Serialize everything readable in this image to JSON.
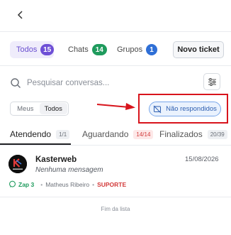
{
  "header": {
    "back_icon": "chevron-left-icon"
  },
  "filters": {
    "items": [
      {
        "label": "Todos",
        "count": "15",
        "color": "#6e4fd6"
      },
      {
        "label": "Chats",
        "count": "14",
        "color": "#1f9b5d"
      },
      {
        "label": "Grupos",
        "count": "1",
        "color": "#2f6fd6"
      }
    ],
    "new_ticket_label": "Novo ticket"
  },
  "search": {
    "placeholder": "Pesquisar conversas...",
    "value": ""
  },
  "scope": {
    "options": [
      "Meus",
      "Todos"
    ],
    "selected": "Todos"
  },
  "unanswered_filter": {
    "label": "Não respondidos",
    "highlight_color": "#d8141c"
  },
  "tabs": [
    {
      "label": "Atendendo",
      "badge": "1/1"
    },
    {
      "label": "Aguardando",
      "badge": "14/14"
    },
    {
      "label": "Finalizados",
      "badge": "20/39"
    }
  ],
  "ticket": {
    "name": "Kasterweb",
    "date": "15/08/2026",
    "last_message": "Nenhuma mensagem",
    "connection": "Zap 3",
    "agent": "Matheus Ribeiro",
    "queue": "SUPORTE"
  },
  "list_end": "Fim da lista"
}
